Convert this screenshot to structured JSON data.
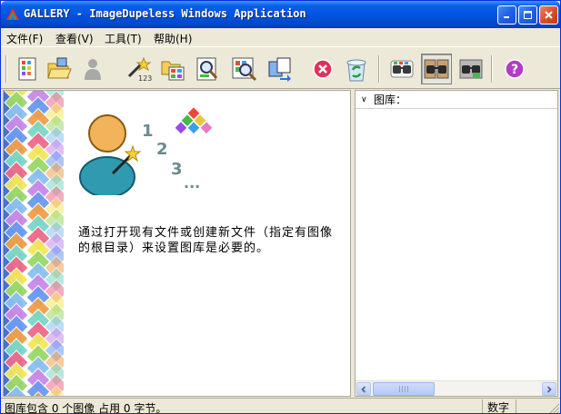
{
  "window": {
    "title": "GALLERY - ImageDupeless Windows Application"
  },
  "menu": {
    "items": [
      {
        "label": "文件(F)"
      },
      {
        "label": "查看(V)"
      },
      {
        "label": "工具(T)"
      },
      {
        "label": "帮助(H)"
      }
    ]
  },
  "toolbar": {
    "icons": [
      "new-gallery-icon",
      "open-gallery-icon",
      "disabled-user-icon",
      "wizard-icon",
      "folder-scan-icon",
      "preview-icon",
      "search-duplicates-icon",
      "compare-icon",
      "stop-icon",
      "recycle-icon",
      "glasses-view-icon",
      "glasses-compare-icon",
      "glasses-settings-icon",
      "help-icon"
    ]
  },
  "main": {
    "hero_numbers": [
      "1",
      "2",
      "3",
      "..."
    ],
    "hint": "通过打开现有文件或创建新文件（指定有图像的根目录）来设置图库是必要的。"
  },
  "tree": {
    "header": "图库：",
    "toggle": "∨"
  },
  "status": {
    "message": "图库包含 0 个图像 占用 0 字节。",
    "mode": "数字"
  },
  "colors": {
    "title_bar": "#0054e3",
    "close_button": "#d9512c",
    "diamond_strip": "#4d6fd0",
    "stop_icon": "#e0305a",
    "help_icon": "#b03cc8"
  }
}
